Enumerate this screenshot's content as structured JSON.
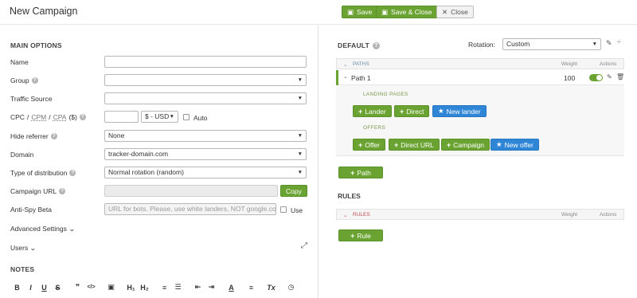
{
  "header": {
    "title": "New Campaign",
    "save_label": "Save",
    "save_close_label": "Save & Close",
    "close_label": "Close"
  },
  "main_options": {
    "section_title": "MAIN OPTIONS",
    "name_label": "Name",
    "group_label": "Group",
    "traffic_source_label": "Traffic Source",
    "cpc_label": "CPC",
    "cpm_label": "CPM",
    "cpa_label": "CPA",
    "currency_suffix": "($)",
    "slash": "/",
    "currency_value": "$ - USD",
    "auto_label": "Auto",
    "hide_referrer_label": "Hide referrer",
    "hide_referrer_value": "None",
    "domain_label": "Domain",
    "domain_value": "tracker-domain.com",
    "distribution_label": "Type of distribution",
    "distribution_value": "Normal rotation (random)",
    "campaign_url_label": "Campaign URL",
    "copy_label": "Copy",
    "anti_spy_label": "Anti-Spy Beta",
    "anti_spy_placeholder": "URL for bots. Please, use white landers, NOT google.com",
    "use_label": "Use",
    "advanced_label": "Advanced Settings",
    "users_label": "Users",
    "notes_label": "NOTES"
  },
  "editor_toolbar": [
    "B",
    "I",
    "U",
    "S",
    "❞",
    "</>",
    "▣",
    "H₁",
    "H₂",
    "≡",
    "☰",
    "⇤",
    "⇥",
    "A",
    "≡",
    "Tx",
    "◷"
  ],
  "default": {
    "section_title": "DEFAULT",
    "rotation_label": "Rotation:",
    "rotation_value": "Custom",
    "paths_header": "PATHS",
    "weight_header": "Weight",
    "actions_header": "Actions",
    "path_name": "Path 1",
    "path_weight": "100",
    "landing_pages_label": "LANDING PAGES",
    "lander_btn": "Lander",
    "direct_btn": "Direct",
    "new_lander_btn": "New lander",
    "offers_label": "OFFERS",
    "offer_btn": "Offer",
    "direct_url_btn": "Direct URL",
    "campaign_btn": "Campaign",
    "new_offer_btn": "New offer",
    "add_path_btn": "Path"
  },
  "rules": {
    "section_title": "RULES",
    "rules_header": "RULES",
    "weight_header": "Weight",
    "actions_header": "Actions",
    "add_rule_btn": "Rule"
  },
  "colors": {
    "green": "#6aa331",
    "blue": "#2f86d6",
    "rules_red": "#c0504d"
  }
}
